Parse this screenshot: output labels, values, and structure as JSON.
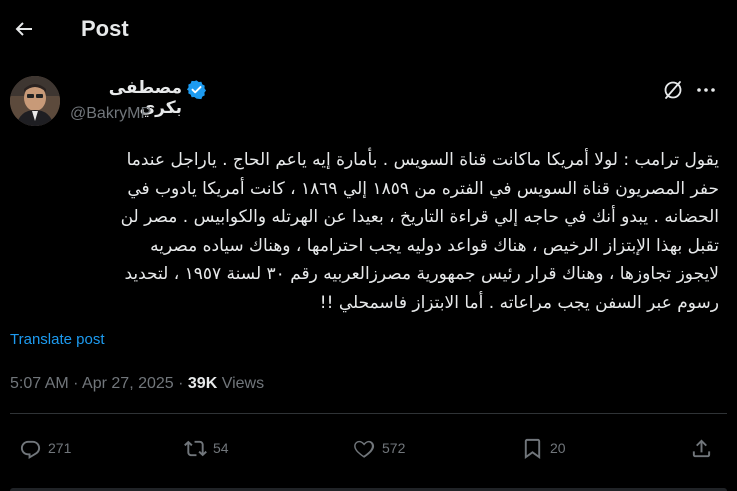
{
  "header": {
    "title": "Post"
  },
  "author": {
    "name": "مصطفى بكري",
    "handle": "@BakryMP"
  },
  "tweet": {
    "lines": [
      "يقول ترامب : لولا أمريكا ماكانت قناة السويس . بأمارة إيه ياعم الحاج . ياراجل عندما",
      "حفر المصريون قناة السويس في الفتره من ١٨٥٩ إلي ١٨٦٩ ، كانت أمريكا يادوب في",
      "الحضانه . يبدو أنك في حاجه إلي قراءة التاريخ ، بعيدا عن الهرتله والكوابيس . مصر لن",
      "تقبل بهذا الإبتزاز الرخيص ، هناك قواعد دوليه يجب احترامها ، وهناك سياده مصريه",
      "لايجوز تجاوزها ، وهناك قرار رئيس جمهورية مصرزالعربيه رقم ٣٠ لسنة ١٩٥٧ ، لتحديد",
      "رسوم عبر السفن يجب مراعاته . أما الابتزاز فاسمحلي !!"
    ],
    "translate_label": "Translate post",
    "time": "5:07 AM",
    "separator": "·",
    "date": "Apr 27, 2025",
    "views_count": "39K",
    "views_label": "Views"
  },
  "actions": {
    "replies": "271",
    "reposts": "54",
    "likes": "572",
    "bookmarks": "20"
  },
  "colors": {
    "accent": "#1d9bf0",
    "muted": "#71767b",
    "text": "#e7e9ea",
    "background": "#000000",
    "divider": "#2f3336"
  }
}
